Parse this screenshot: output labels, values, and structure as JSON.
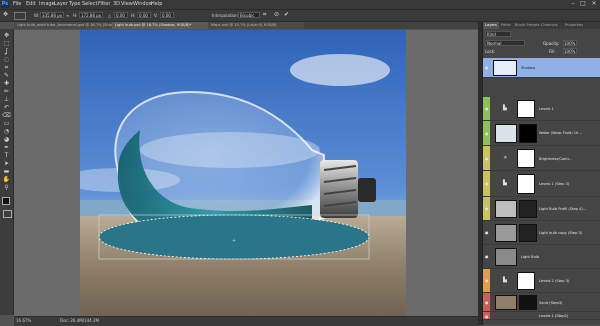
{
  "app": {
    "logo": "Ps"
  },
  "menu": [
    "File",
    "Edit",
    "Image",
    "Layer",
    "Type",
    "Select",
    "Filter",
    "3D",
    "View",
    "Window",
    "Help"
  ],
  "window_controls": [
    "–",
    "□",
    "✕"
  ],
  "options": {
    "width_label": "W:",
    "width_value": "335.86 px",
    "height_label": "H:",
    "height_value": "172.86 px",
    "angle_value": "0.00",
    "h_label": "H:",
    "h_value": "0.00",
    "v_label": "V:",
    "v_value": "0.00",
    "interpolation_label": "Interpolation:",
    "interpolation_value": "Bicubic"
  },
  "doc_tabs": [
    "Light bulb_aroid tutor_fenomenal.psd @ 16.7% (Shadow, RGB/8)",
    "Light bulb.psd @ 16.7% (Shadow, RGB/8)*",
    "Maps and @ 15.7% (Layer 6, RGB/8)"
  ],
  "tool_icons": [
    "move-icon",
    "marquee-icon",
    "lasso-icon",
    "quick-select-icon",
    "crop-icon",
    "eyedropper-icon",
    "healing-icon",
    "brush-icon",
    "stamp-icon",
    "history-brush-icon",
    "eraser-icon",
    "gradient-icon",
    "blur-icon",
    "dodge-icon",
    "pen-icon",
    "type-icon",
    "path-select-icon",
    "shape-icon",
    "hand-icon",
    "zoom-icon"
  ],
  "tool_glyphs": [
    "✥",
    "⬚",
    "ʆ",
    "◌",
    "⌗",
    "✎",
    "✚",
    "✏",
    "⊥",
    "↶",
    "⌫",
    "▭",
    "◔",
    "◕",
    "✒",
    "T",
    "➤",
    "▬",
    "✋",
    "⚲"
  ],
  "status": {
    "zoom": "16.67%",
    "doc": "Doc: 26.4M/144.2M"
  },
  "panel_tabs": [
    "Layers",
    "Paths",
    "Brush Presets",
    "Channels",
    "Properties"
  ],
  "panel": {
    "kind": "Kind",
    "blend_mode": "Normal",
    "opacity_label": "Opacity:",
    "opacity_value": "100%",
    "lock_label": "Lock:",
    "fill_label": "Fill:",
    "fill_value": "100%"
  },
  "layers": [
    {
      "name": "Shadow",
      "selected": true,
      "tag": "#b6cef2"
    },
    {
      "name": "Levels 1",
      "tag": "#8dbf5a"
    },
    {
      "name": "Water (Warp Fluid) 10...",
      "tag": "#8dbf5a"
    },
    {
      "name": "Brightness/Contr...",
      "tag": "#c8c35b"
    },
    {
      "name": "Levels 1 (Step 3)",
      "tag": "#c8c35b"
    },
    {
      "name": "Light Bulb Profil (Step 4)...",
      "tag": "#c8c35b"
    },
    {
      "name": "Light bulb copy (Step 3)",
      "tag": "#454545"
    },
    {
      "name": "Light Bulb",
      "tag": "#454545"
    },
    {
      "name": "Levels 2 (Step 3)",
      "tag": "#e0a04a"
    },
    {
      "name": "Sand (Step3)",
      "tag": "#d35a5a"
    },
    {
      "name": "Levels 1 (Step2)",
      "tag": "#d35a5a"
    }
  ],
  "panel_footer_icons": [
    "link-icon",
    "fx-icon",
    "mask-icon",
    "adjustment-icon",
    "folder-icon",
    "new-layer-icon",
    "trash-icon"
  ],
  "panel_footer_glyphs": [
    "∞",
    "fx",
    "◙",
    "◐",
    "▭",
    "❐",
    "🗑"
  ]
}
